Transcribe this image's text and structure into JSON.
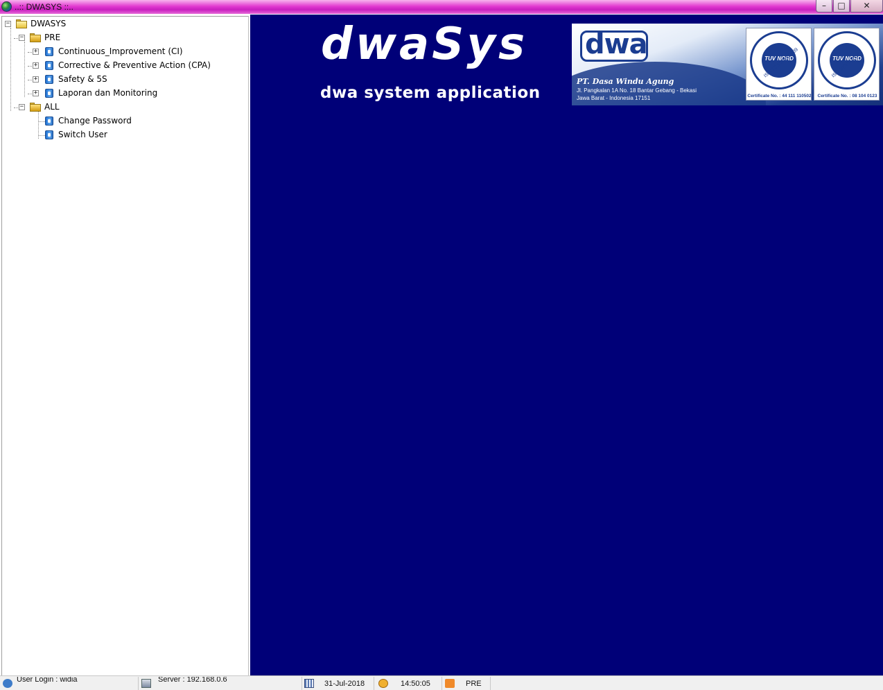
{
  "window": {
    "title": "..:: DWASYS ::..",
    "controls": {
      "minimize": "–",
      "maximize": "□",
      "close": "✕"
    }
  },
  "tree": {
    "root": {
      "label": "DWASYS",
      "icon": "folder-icon",
      "expander": "−"
    },
    "groups": [
      {
        "label": "PRE",
        "icon": "folder-open-icon",
        "expander": "−",
        "items": [
          {
            "label": "Continuous_Improvement (CI)",
            "icon": "module-icon",
            "expander": "+"
          },
          {
            "label": "Corrective & Preventive Action (CPA)",
            "icon": "module-icon",
            "expander": "+"
          },
          {
            "label": "Safety & 5S",
            "icon": "module-icon",
            "expander": "+"
          },
          {
            "label": "Laporan dan Monitoring",
            "icon": "module-icon",
            "expander": "+"
          }
        ]
      },
      {
        "label": "ALL",
        "icon": "folder-open-icon",
        "expander": "−",
        "items": [
          {
            "label": "Change Password",
            "icon": "module-icon"
          },
          {
            "label": "Switch User",
            "icon": "module-icon"
          }
        ]
      }
    ]
  },
  "branding": {
    "title": "dwaSys",
    "subtitle": "dwa system application",
    "banner": {
      "logo": "dwa",
      "company": "PT. Dasa Windu Agung",
      "address1": "Jl. Pangkalan 1A No. 18 Bantar Gebang - Bekasi",
      "address2": "Jawa Barat - Indonesia 17151",
      "certs": [
        {
          "seal": "TUV NORD",
          "standard": "ISO/TS 16949:2009",
          "number": "Certificate No. : 44 111 110502"
        },
        {
          "seal": "TUV NORD",
          "standard": "ISO 14001:2004",
          "number": "Certificate No. : 08 104 0123"
        }
      ]
    },
    "colors": {
      "background": "#000078",
      "brand_blue": "#1b3d91",
      "titlebar_accent": "#e23bd0"
    }
  },
  "status": {
    "user": "User Login : widia",
    "server": "Server : 192.168.0.6",
    "date": "31-Jul-2018",
    "time": "14:50:05",
    "plant": "PRE"
  }
}
